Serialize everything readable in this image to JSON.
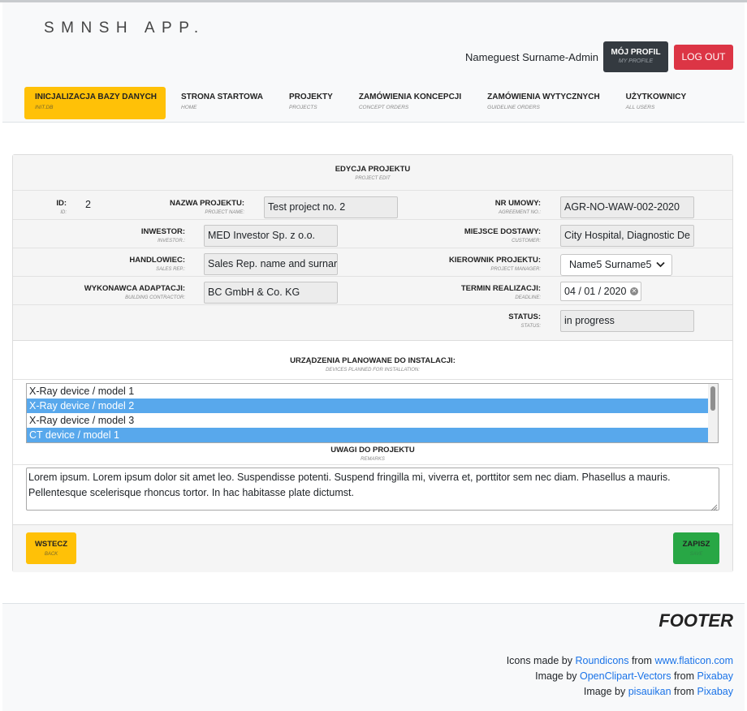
{
  "app": {
    "brand": "SMNSH APP."
  },
  "header": {
    "username": "Nameguest Surname-Admin",
    "profile": {
      "label": "MÓJ PROFIL",
      "sub": "MY PROFILE"
    },
    "logout": "LOG OUT"
  },
  "nav": [
    {
      "label": "INICJALIZACJA BAZY DANYCH",
      "sub": "INIT.DB",
      "active": true
    },
    {
      "label": "STRONA STARTOWA",
      "sub": "HOME"
    },
    {
      "label": "PROJEKTY",
      "sub": "PROJECTS"
    },
    {
      "label": "ZAMÓWIENIA KONCEPCJI",
      "sub": "CONCEPT ORDERS"
    },
    {
      "label": "ZAMÓWIENIA WYTYCZNYCH",
      "sub": "GUIDELINE ORDERS"
    },
    {
      "label": "UŻYTKOWNICY",
      "sub": "ALL USERS"
    }
  ],
  "form": {
    "title": "EDYCJA PROJEKTU",
    "title_sub": "PROJECT EDIT",
    "id": {
      "label": "ID:",
      "sub": "ID:",
      "value": "2"
    },
    "name": {
      "label": "NAZWA PROJEKTU:",
      "sub": "PROJECT NAME:",
      "value": "Test project no. 2"
    },
    "agreement": {
      "label": "NR UMOWY:",
      "sub": "AGREEMENT NO.:",
      "value": "AGR-NO-WAW-002-2020"
    },
    "investor": {
      "label": "INWESTOR:",
      "sub": "INVESTOR.:",
      "value": "MED Investor Sp. z o.o."
    },
    "customer": {
      "label": "MIEJSCE DOSTAWY:",
      "sub": "CUSTOMER:",
      "value": "City Hospital, Diagnostic De"
    },
    "sales": {
      "label": "HANDLOWIEC:",
      "sub": "SALES REP.:",
      "value": "Sales Rep. name and surnar"
    },
    "manager": {
      "label": "KIEROWNIK PROJEKTU:",
      "sub": "PROJECT MANAGER:",
      "value": "Name5 Surname5"
    },
    "contractor": {
      "label": "WYKONAWCA ADAPTACJI:",
      "sub": "BUILDING CONTRACTOR:",
      "value": "BC GmbH & Co. KG"
    },
    "deadline": {
      "label": "TERMIN REALIZACJI:",
      "sub": "DEADLINE:",
      "value": "04 / 01 / 2020"
    },
    "status": {
      "label": "STATUS:",
      "sub": "STATUS:",
      "value": "in progress"
    },
    "devices": {
      "label": "URZĄDZENIA PLANOWANE DO INSTALACJI:",
      "sub": "DEVICES PLANNED FOR INSTALLATION:",
      "items": [
        {
          "text": "X-Ray device / model 1",
          "selected": false
        },
        {
          "text": "X-Ray device / model 2",
          "selected": true
        },
        {
          "text": "X-Ray device / model 3",
          "selected": false
        },
        {
          "text": "CT device / model 1",
          "selected": true
        }
      ]
    },
    "remarks": {
      "label": "UWAGI DO PROJEKTU",
      "sub": "REMARKS",
      "value": "Lorem ipsum. Lorem ipsum dolor sit amet leo. Suspendisse potenti. Suspend fringilla mi, viverra et, porttitor sem nec diam. Phasellus a mauris. Pellentesque scelerisque rhoncus tortor. In hac habitasse plate dictumst."
    },
    "back": {
      "label": "WSTECZ",
      "sub": "BACK"
    },
    "save": {
      "label": "ZAPISZ",
      "sub": "SAVE"
    }
  },
  "footer": {
    "title": "FOOTER",
    "credits": [
      {
        "prefix": "Icons made by ",
        "author": "Roundicons",
        "mid": " from ",
        "source": "www.flaticon.com"
      },
      {
        "prefix": "Image by ",
        "author": "OpenClipart-Vectors",
        "mid": " from ",
        "source": "Pixabay"
      },
      {
        "prefix": "Image by ",
        "author": "pisauikan",
        "mid": " from ",
        "source": "Pixabay"
      }
    ]
  }
}
